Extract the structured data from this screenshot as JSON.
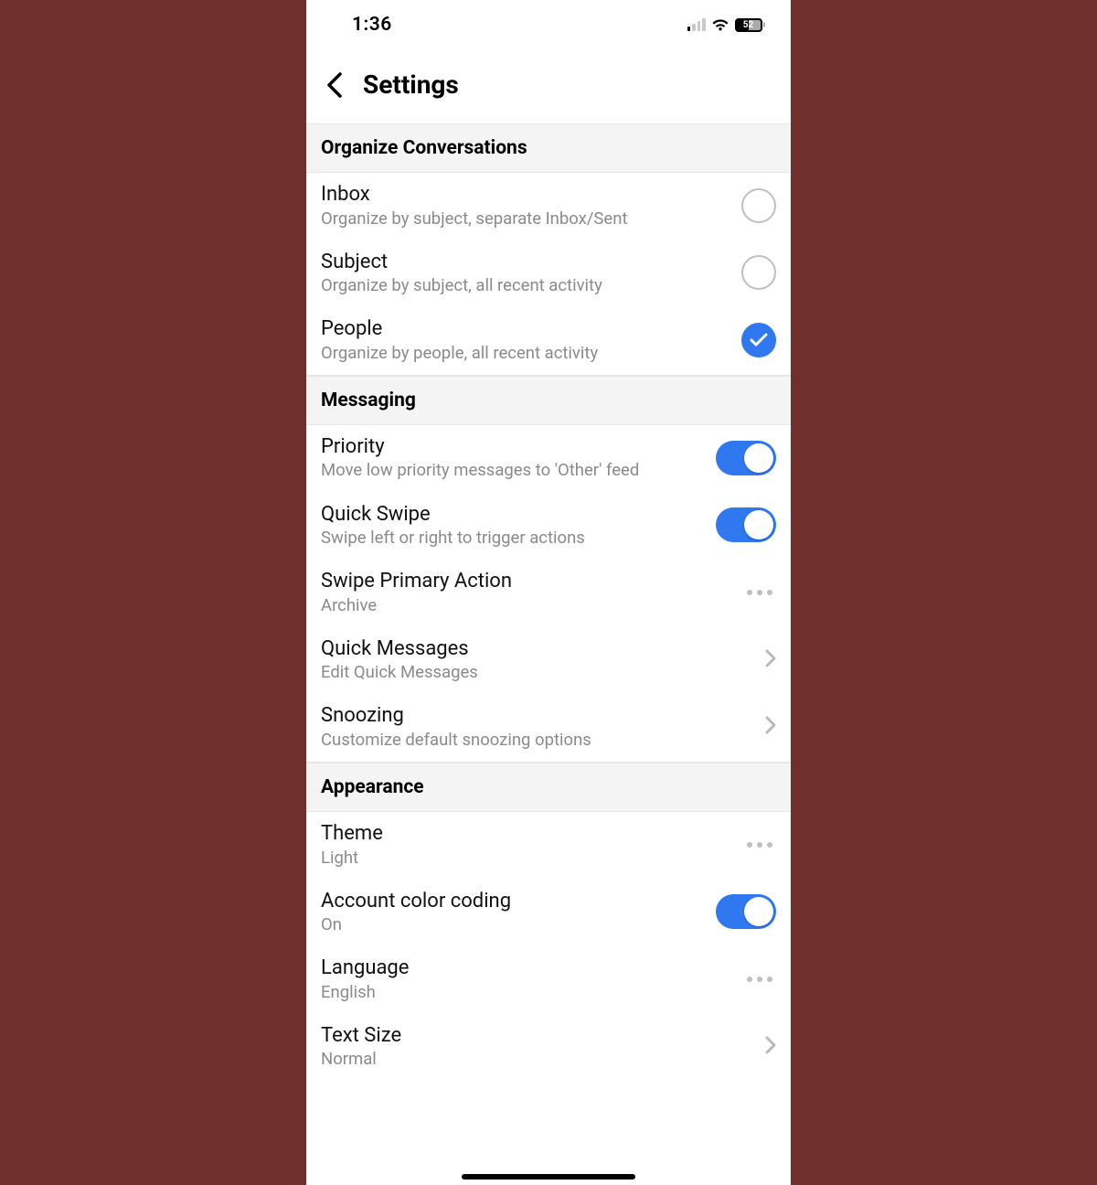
{
  "status": {
    "time": "1:36",
    "battery": "52"
  },
  "nav": {
    "title": "Settings"
  },
  "sections": {
    "organize": {
      "header": "Organize Conversations",
      "inbox": {
        "title": "Inbox",
        "sub": "Organize by subject, separate Inbox/Sent",
        "selected": false
      },
      "subject": {
        "title": "Subject",
        "sub": "Organize by subject, all recent activity",
        "selected": false
      },
      "people": {
        "title": "People",
        "sub": "Organize by people, all recent activity",
        "selected": true
      }
    },
    "messaging": {
      "header": "Messaging",
      "priority": {
        "title": "Priority",
        "sub": "Move low priority messages to 'Other' feed",
        "on": true
      },
      "quickswipe": {
        "title": "Quick Swipe",
        "sub": "Swipe left or right to trigger actions",
        "on": true
      },
      "swipeprimary": {
        "title": "Swipe Primary Action",
        "sub": "Archive"
      },
      "quickmessages": {
        "title": "Quick Messages",
        "sub": "Edit Quick Messages"
      },
      "snoozing": {
        "title": "Snoozing",
        "sub": "Customize default snoozing options"
      }
    },
    "appearance": {
      "header": "Appearance",
      "theme": {
        "title": "Theme",
        "sub": "Light"
      },
      "colorcoding": {
        "title": "Account color coding",
        "sub": "On",
        "on": true
      },
      "language": {
        "title": "Language",
        "sub": "English"
      },
      "textsize": {
        "title": "Text Size",
        "sub": "Normal"
      }
    }
  }
}
